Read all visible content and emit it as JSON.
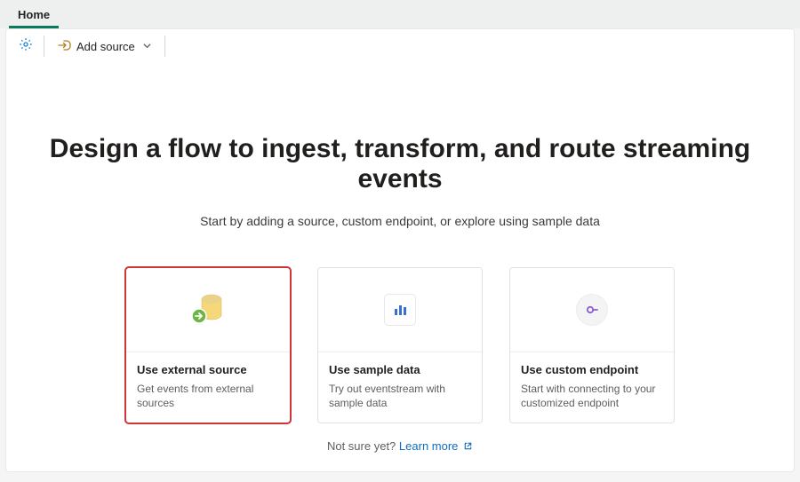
{
  "tab": {
    "label": "Home"
  },
  "toolbar": {
    "add_source_label": "Add source"
  },
  "hero": {
    "title": "Design a flow to ingest, transform, and route streaming events",
    "subtitle": "Start by adding a source, custom endpoint, or explore using sample data"
  },
  "cards": {
    "external": {
      "title": "Use external source",
      "desc": "Get events from external sources"
    },
    "sample": {
      "title": "Use sample data",
      "desc": "Try out eventstream with sample data"
    },
    "endpoint": {
      "title": "Use custom endpoint",
      "desc": "Start with connecting to your customized endpoint"
    }
  },
  "footer": {
    "hint": "Not sure yet?",
    "learn": "Learn more"
  }
}
